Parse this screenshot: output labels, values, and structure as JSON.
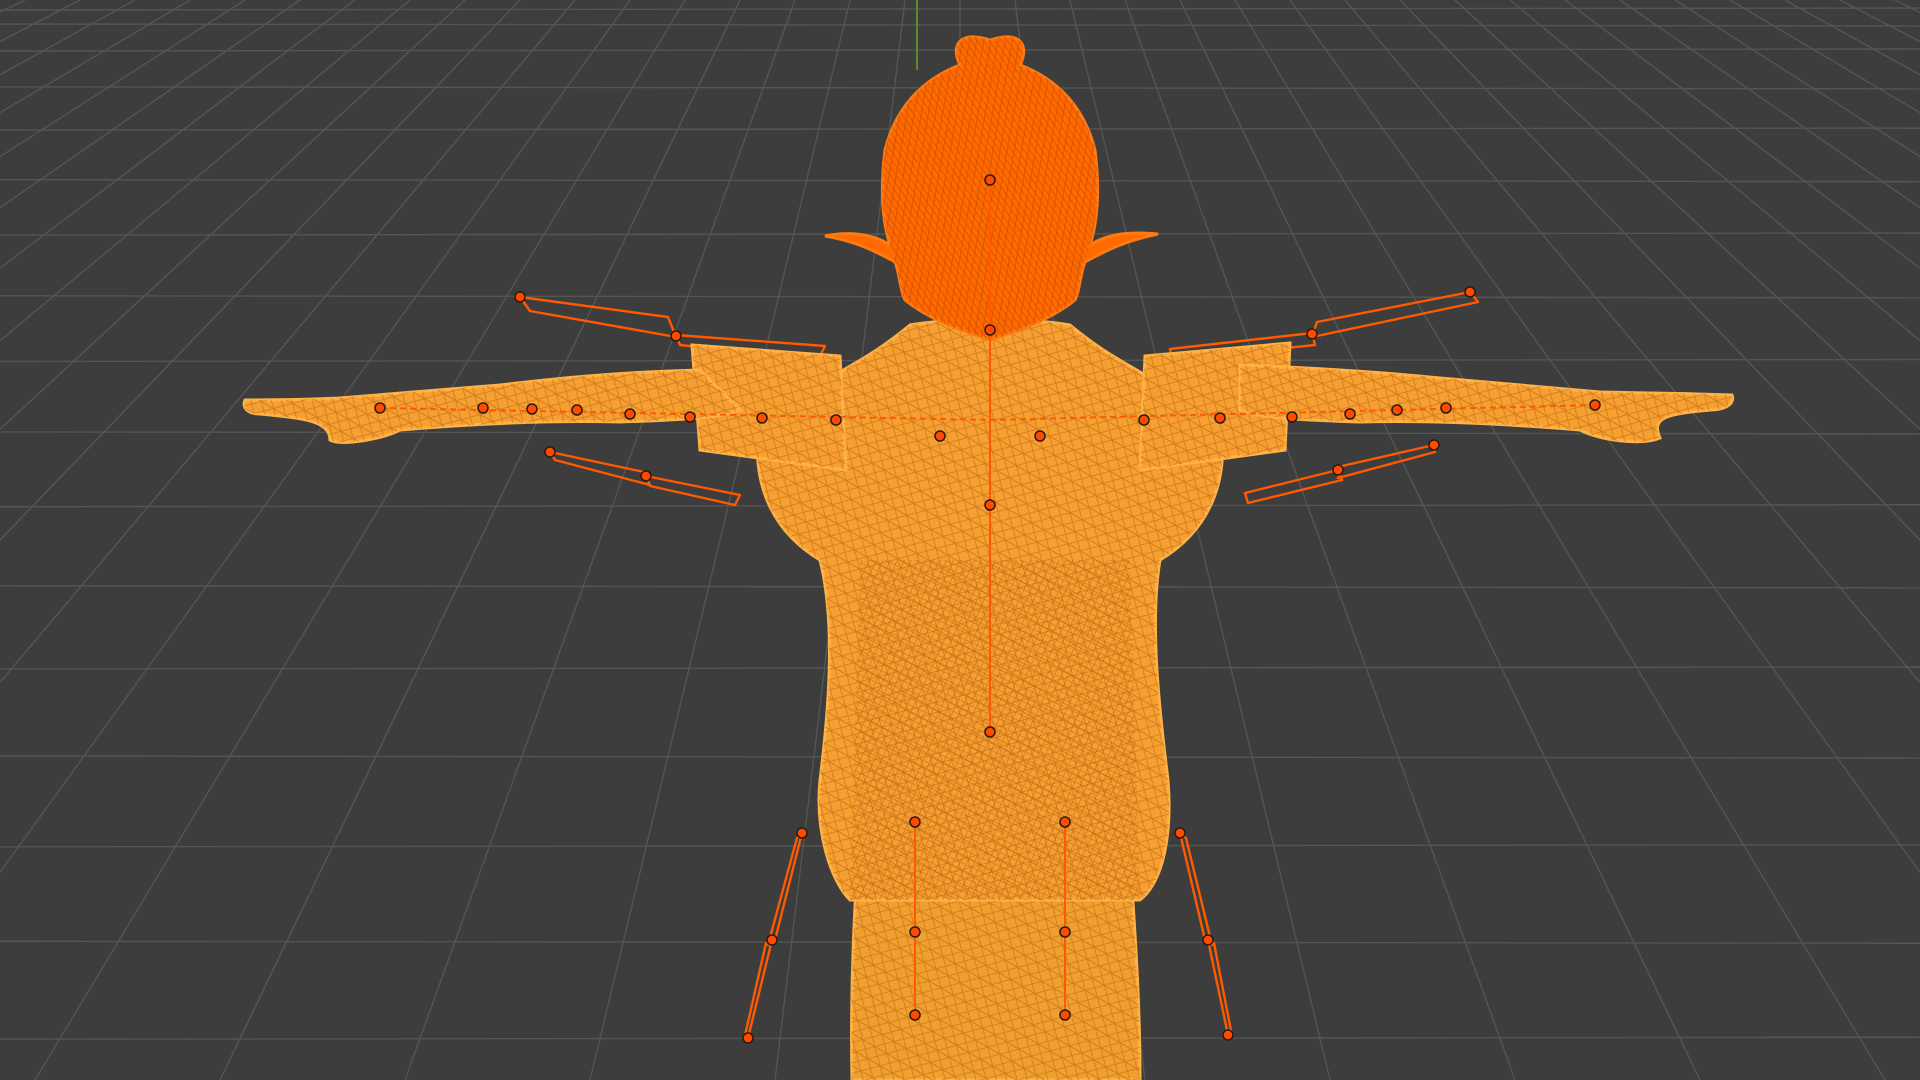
{
  "app": {
    "editor": "3d-viewport",
    "shading_mode": "wireframe",
    "view": "front"
  },
  "colors": {
    "background": "#3d3d3d",
    "grid_line": "#555555",
    "z_axis": "#5a8a2a",
    "mesh_fill": "#f5a030",
    "mesh_wire": "#ffb347",
    "hair": "#ff6a00",
    "armature": "#ff5a00",
    "joint_fill": "#ff4a00",
    "joint_ring": "#2a1a10"
  },
  "scene": {
    "objects": [
      {
        "name": "character-mesh",
        "selected": true
      },
      {
        "name": "armature",
        "selected": true
      }
    ]
  }
}
